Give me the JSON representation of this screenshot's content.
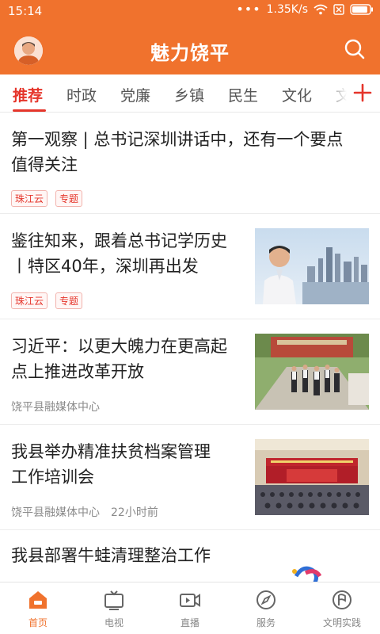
{
  "status_bar": {
    "time": "15:14",
    "dots": "•••",
    "network_speed": "1.35K/s"
  },
  "header": {
    "title": "魅力饶平"
  },
  "tabs": [
    {
      "label": "推荐",
      "active": true
    },
    {
      "label": "时政"
    },
    {
      "label": "党廉"
    },
    {
      "label": "乡镇"
    },
    {
      "label": "民生"
    },
    {
      "label": "文化"
    },
    {
      "label": "文"
    }
  ],
  "feed": [
    {
      "headline_lines": [
        "第一观察 | 总书记深圳讲话中，还有一个要点",
        "值得关注"
      ],
      "tags": [
        "珠江云",
        "专题"
      ]
    },
    {
      "headline_lines": [
        "鉴往知来，跟着总书记学历史",
        "丨特区40年，深圳再出发"
      ],
      "tags": [
        "珠江云",
        "专题"
      ],
      "thumb": "portrait-city"
    },
    {
      "headline_lines": [
        "习近平：以更大魄力在更高起",
        "点上推进改革开放"
      ],
      "source": "饶平县融媒体中心",
      "thumb": "walking-group"
    },
    {
      "headline_lines": [
        "我县举办精准扶贫档案管理",
        "工作培训会"
      ],
      "source": "饶平县融媒体中心",
      "time": "22小时前",
      "thumb": "meeting-hall"
    },
    {
      "headline_lines": [
        "我县部署牛蛙清理整治工作"
      ]
    }
  ],
  "bottom_nav": [
    {
      "label": "首页",
      "icon": "home-icon",
      "active": true
    },
    {
      "label": "电视",
      "icon": "tv-icon"
    },
    {
      "label": "直播",
      "icon": "live-icon"
    },
    {
      "label": "服务",
      "icon": "compass-icon"
    },
    {
      "label": "文明实践",
      "icon": "flag-icon"
    }
  ],
  "colors": {
    "brand": "#f0722d",
    "accent": "#e5352b"
  }
}
